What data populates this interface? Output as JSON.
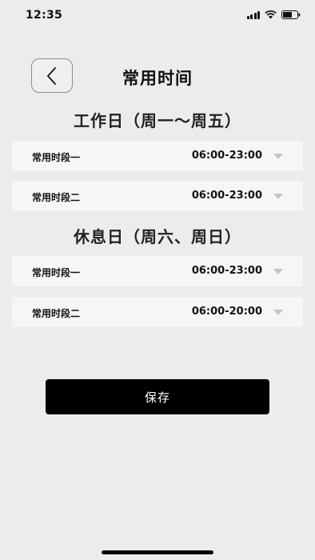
{
  "status_bar": {
    "time": "12:35",
    "icons": [
      "signal-icon",
      "wifi-icon",
      "battery-icon"
    ]
  },
  "header": {
    "back_icon": "chevron-left-icon",
    "title": "常用时间"
  },
  "workday": {
    "title": "工作日（周一～周五）",
    "rows": [
      {
        "label": "常用时段一",
        "value": "06:00-23:00"
      },
      {
        "label": "常用时段二",
        "value": "06:00-23:00"
      }
    ]
  },
  "restday": {
    "title": "休息日（周六、周日）",
    "rows": [
      {
        "label": "常用时段一",
        "value": "06:00-23:00"
      },
      {
        "label": "常用时段二",
        "value": "06:00-20:00"
      }
    ]
  },
  "save_label": "保存",
  "colors": {
    "background": "#ececec",
    "row_background": "#f6f6f6",
    "primary_button": "#000000",
    "dropdown_arrow": "#c4c4c4"
  }
}
